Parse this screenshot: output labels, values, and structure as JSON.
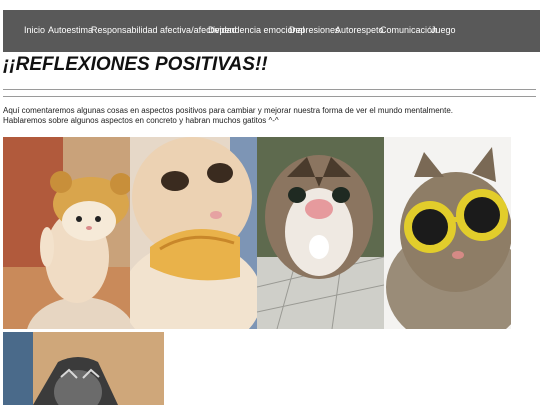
{
  "nav": {
    "items": [
      "Inicio",
      "Autoestima",
      "Responsabilidad afectiva/afectividad",
      "Dependencia emocional",
      "Depresiones",
      "Autorespeto",
      "Comunicación",
      "Juego"
    ]
  },
  "page": {
    "title": "¡¡REFLEXIONES POSITIVAS!!",
    "intro_line_1": "Aquí comentaremos algunas cosas en aspectos positivos para cambiar y mejorar nuestra forma de ver el mundo mentalmente.",
    "intro_line_2": "Hablaremos sobre algunos aspectos en concreto y habran muchos gatitos ^-^"
  },
  "gallery": [
    {
      "icon": "cat-in-bear-hat-photo"
    },
    {
      "icon": "cat-with-bread-photo"
    },
    {
      "icon": "cat-closeup-face-photo"
    },
    {
      "icon": "cat-with-yellow-sunglasses-photo"
    },
    {
      "icon": "cat-in-box-photo"
    }
  ],
  "colors": {
    "navbar_bg": "#595959",
    "nav_text": "#ffffff",
    "rule": "#9a9a9a"
  }
}
